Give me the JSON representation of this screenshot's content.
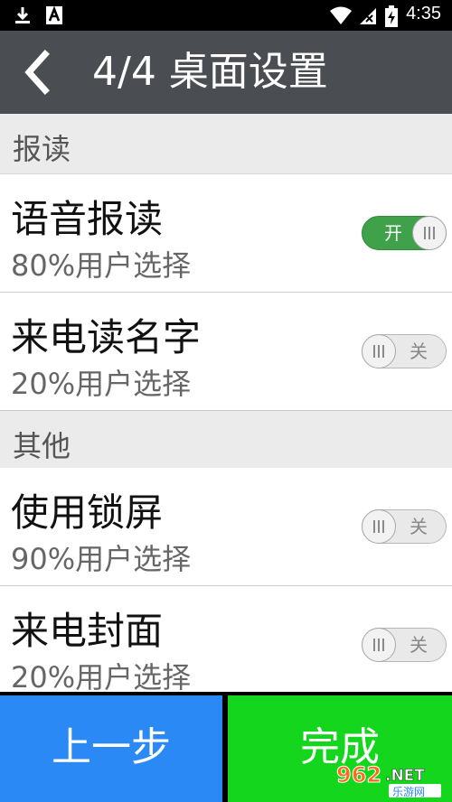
{
  "status_bar": {
    "time": "4:35",
    "icons": [
      "download-icon",
      "text-a-icon",
      "wifi-icon",
      "signal-icon",
      "battery-charging-icon"
    ]
  },
  "header": {
    "back_icon": "chevron-left-icon",
    "title": "4/4 桌面设置"
  },
  "sections": [
    {
      "label": "报读",
      "items": [
        {
          "title": "语音报读",
          "subtitle": "80%用户选择",
          "state": "开"
        },
        {
          "title": "来电读名字",
          "subtitle": "20%用户选择",
          "state": "关"
        }
      ]
    },
    {
      "label": "其他",
      "items": [
        {
          "title": "使用锁屏",
          "subtitle": "90%用户选择",
          "state": "关"
        },
        {
          "title": "来电封面",
          "subtitle": "20%用户选择",
          "state": "关"
        }
      ]
    }
  ],
  "footer": {
    "prev_label": "上一步",
    "done_label": "完成"
  },
  "watermark": {
    "brand": "962.NET",
    "caption": "乐游网"
  },
  "colors": {
    "app_bar": "#4a4d52",
    "toggle_on": "#3fa24a",
    "prev_button": "#2a89f5",
    "done_button": "#13d61d"
  }
}
